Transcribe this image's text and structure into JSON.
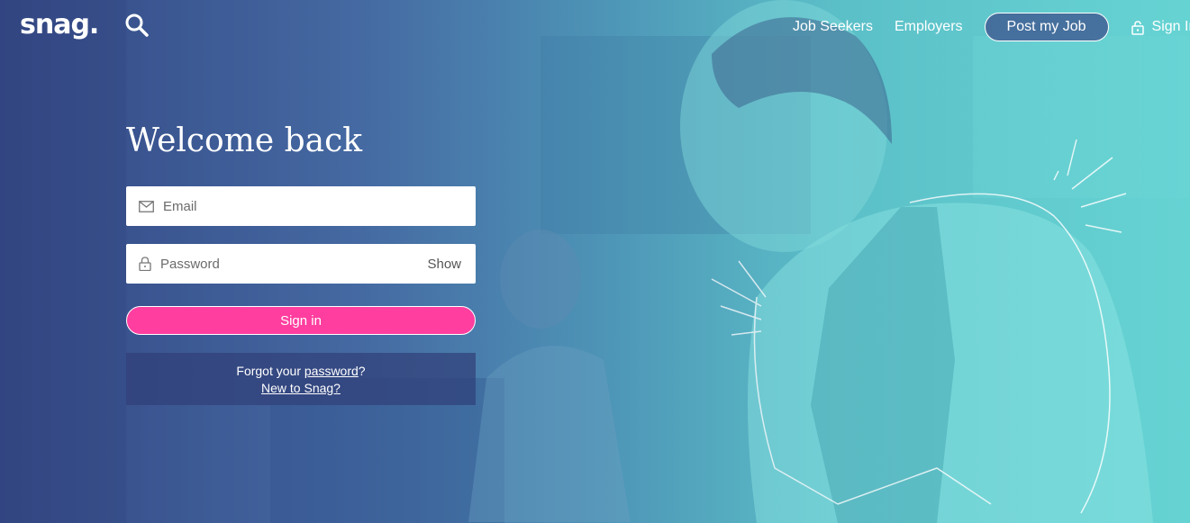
{
  "header": {
    "logo_text": "snag.",
    "nav": {
      "job_seekers": "Job Seekers",
      "employers": "Employers",
      "post_job": "Post my Job",
      "sign_in": "Sign In"
    }
  },
  "form": {
    "title": "Welcome back",
    "email_placeholder": "Email",
    "password_placeholder": "Password",
    "show_label": "Show",
    "submit_label": "Sign in",
    "forgot_prefix": "Forgot your ",
    "forgot_link": "password",
    "forgot_suffix": "?",
    "new_link": "New to Snag?"
  },
  "icons": {
    "search": "search-icon",
    "lock": "lock-icon",
    "envelope": "envelope-icon"
  },
  "colors": {
    "accent_pink": "#ff3e9f",
    "bg_left": "#3a4f8c",
    "bg_right": "#66d3d3",
    "help_box": "#303e78"
  }
}
